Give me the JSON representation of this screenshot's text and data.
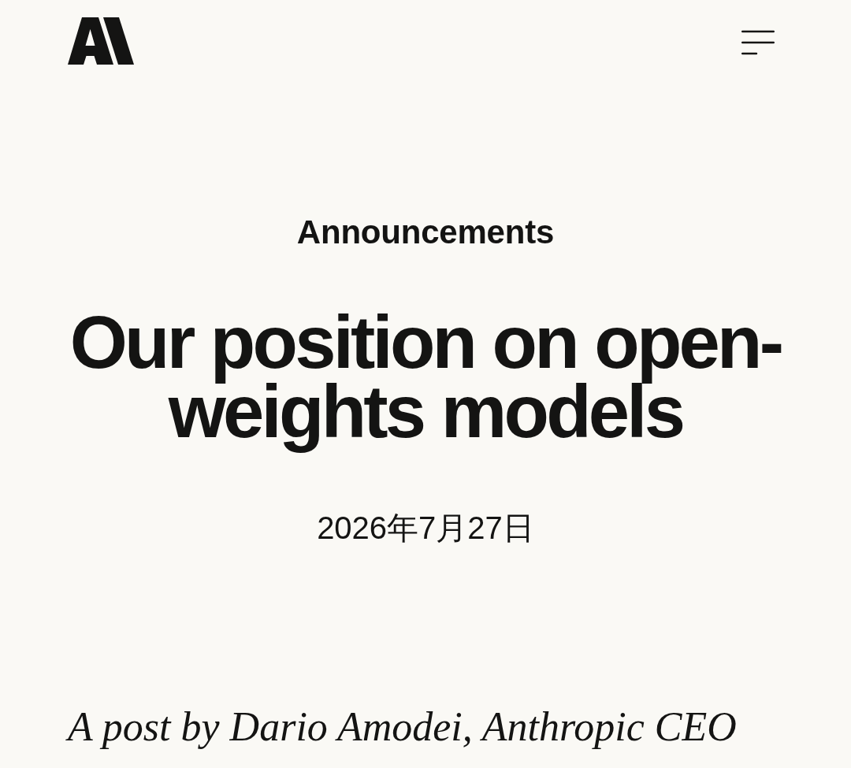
{
  "article": {
    "category": "Announcements",
    "title": "Our position on open-weights models",
    "date": "2026年7月27日",
    "byline": "A post by Dario Amodei, Anthropic CEO"
  }
}
